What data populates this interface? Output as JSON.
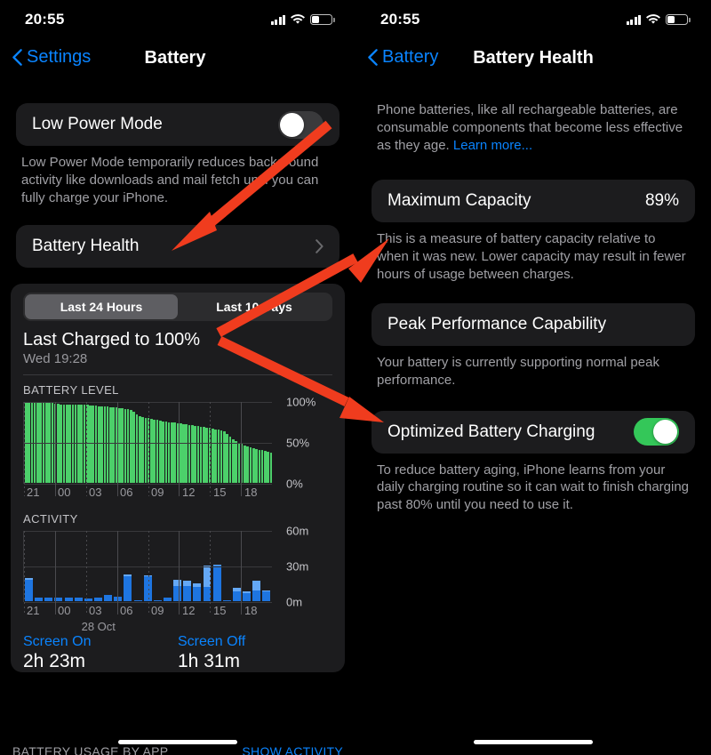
{
  "left_screen": {
    "status_bar": {
      "time": "20:55",
      "icons": [
        "cellular-signal-icon",
        "wifi-icon",
        "battery-icon"
      ],
      "battery_fill_pct": 35
    },
    "nav": {
      "back_label": "Settings",
      "title": "Battery",
      "back_icon": "chevron-left-icon"
    },
    "low_power_mode": {
      "label": "Low Power Mode",
      "toggle_state": "off",
      "footnote": "Low Power Mode temporarily reduces background activity like downloads and mail fetch until you can fully charge your iPhone."
    },
    "battery_health_row": {
      "label": "Battery Health",
      "accessory_icon": "chevron-right-icon"
    },
    "usage": {
      "segments": [
        {
          "label": "Last 24 Hours",
          "selected": true
        },
        {
          "label": "Last 10 Days",
          "selected": false
        }
      ],
      "last_charged_title": "Last Charged to 100%",
      "last_charged_sub": "Wed 19:28",
      "battery_level_title": "BATTERY LEVEL",
      "activity_title": "ACTIVITY",
      "day_label": "28 Oct",
      "screen_on_label": "Screen On",
      "screen_on_value": "2h 23m",
      "screen_off_label": "Screen Off",
      "screen_off_value": "1h 31m",
      "footer_left": "BATTERY USAGE BY APP",
      "footer_right": "SHOW ACTIVITY"
    }
  },
  "right_screen": {
    "status_bar": {
      "time": "20:55",
      "icons": [
        "cellular-signal-icon",
        "wifi-icon",
        "battery-icon"
      ],
      "battery_fill_pct": 35
    },
    "nav": {
      "back_label": "Battery",
      "title": "Battery Health",
      "back_icon": "chevron-left-icon"
    },
    "intro": {
      "text": "Phone batteries, like all rechargeable batteries, are consumable components that become less effective as they age. ",
      "link": "Learn more..."
    },
    "maximum_capacity": {
      "label": "Maximum Capacity",
      "value": "89%",
      "footnote": "This is a measure of battery capacity relative to when it was new. Lower capacity may result in fewer hours of usage between charges."
    },
    "peak_performance": {
      "label": "Peak Performance Capability",
      "footnote": "Your battery is currently supporting normal peak performance."
    },
    "optimized_charging": {
      "label": "Optimized Battery Charging",
      "toggle_state": "on",
      "footnote": "To reduce battery aging, iPhone learns from your daily charging routine so it can wait to finish charging past 80% until you need to use it."
    }
  },
  "colors": {
    "accent_blue": "#0a84ff",
    "toggle_on_green": "#34c759",
    "battery_bar_green": "#4cd06a",
    "activity_bar_blue": "#1e75e0",
    "activity_bar_blue_light": "#64a8f5",
    "card_bg": "#1c1c1e",
    "arrow_red": "#f03c1e"
  },
  "annotations": {
    "arrows": [
      {
        "name": "arrow-to-battery-health",
        "points_to": "Battery Health"
      },
      {
        "name": "arrow-to-maximum-capacity",
        "points_to": "Maximum Capacity"
      },
      {
        "name": "arrow-to-optimized-battery-charging",
        "points_to": "Optimized Battery Charging"
      }
    ]
  },
  "chart_data": [
    {
      "type": "bar",
      "title": "BATTERY LEVEL",
      "ylabel": "",
      "xlabel": "",
      "ylim": [
        0,
        100
      ],
      "yticks": [
        "0%",
        "50%",
        "100%"
      ],
      "xticks": [
        "21",
        "00",
        "03",
        "06",
        "09",
        "12",
        "15",
        "18"
      ],
      "grid": true,
      "series_color": "#4cd06a",
      "values": [
        100,
        100,
        100,
        100,
        100,
        100,
        100,
        100,
        99,
        99,
        98,
        98,
        97,
        97,
        97,
        97,
        97,
        97,
        96,
        96,
        96,
        96,
        95,
        95,
        95,
        94,
        94,
        94,
        94,
        93,
        93,
        93,
        92,
        92,
        91,
        91,
        90,
        88,
        84,
        82,
        81,
        80,
        80,
        79,
        78,
        78,
        77,
        76,
        76,
        75,
        74,
        74,
        73,
        73,
        72,
        72,
        71,
        71,
        70,
        70,
        69,
        69,
        68,
        68,
        67,
        66,
        66,
        65,
        63,
        60,
        57,
        54,
        51,
        49,
        48,
        46,
        45,
        44,
        43,
        42,
        41,
        40,
        39,
        38,
        37
      ]
    },
    {
      "type": "bar",
      "title": "ACTIVITY",
      "ylabel": "",
      "xlabel": "28 Oct",
      "ylim": [
        0,
        60
      ],
      "yticks": [
        "0m",
        "30m",
        "60m"
      ],
      "xticks": [
        "21",
        "00",
        "03",
        "06",
        "09",
        "12",
        "15",
        "18"
      ],
      "grid": true,
      "stacked": true,
      "series": [
        {
          "name": "screen-off",
          "color": "#1e75e0",
          "values": [
            18,
            3,
            3,
            3,
            3,
            3,
            2,
            3,
            5,
            4,
            21,
            1,
            21,
            1,
            3,
            13,
            13,
            12,
            12,
            30,
            1,
            8,
            7,
            9,
            8
          ]
        },
        {
          "name": "screen-on",
          "color": "#64a8f5",
          "values": [
            2,
            0,
            0,
            0,
            0,
            0,
            0,
            0,
            0,
            0,
            2,
            0,
            1,
            0,
            0,
            5,
            4,
            3,
            18,
            1,
            0,
            3,
            1,
            8,
            1
          ]
        }
      ]
    }
  ]
}
